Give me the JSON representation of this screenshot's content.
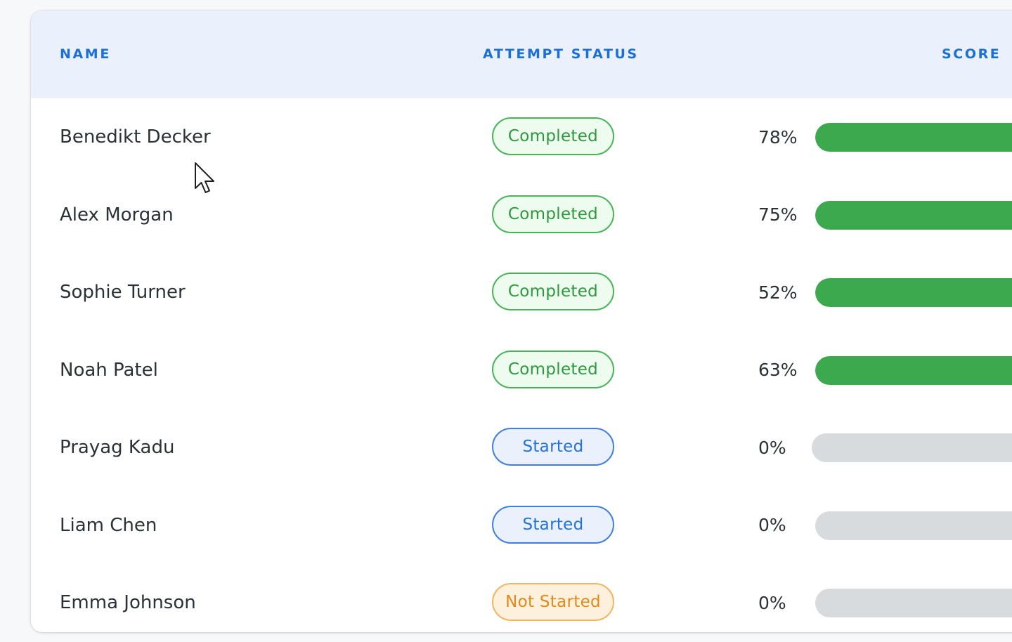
{
  "table": {
    "headers": {
      "name": "NAME",
      "status": "ATTEMPT STATUS",
      "score": "SCORE"
    },
    "rows": [
      {
        "name": "Benedikt Decker",
        "status": "Completed",
        "status_kind": "completed",
        "score": "78%",
        "score_value": 0.78
      },
      {
        "name": "Alex Morgan",
        "status": "Completed",
        "status_kind": "completed",
        "score": "75%",
        "score_value": 0.75
      },
      {
        "name": "Sophie Turner",
        "status": "Completed",
        "status_kind": "completed",
        "score": "52%",
        "score_value": 0.52
      },
      {
        "name": "Noah Patel",
        "status": "Completed",
        "status_kind": "completed",
        "score": "63%",
        "score_value": 0.63
      },
      {
        "name": "Prayag Kadu",
        "status": "Started",
        "status_kind": "started",
        "score": "0%",
        "score_value": 0
      },
      {
        "name": "Liam Chen",
        "status": "Started",
        "status_kind": "started",
        "score": "0%",
        "score_value": 0
      },
      {
        "name": "Emma Johnson",
        "status": "Not Started",
        "status_kind": "not-started",
        "score": "0%",
        "score_value": 0
      }
    ]
  },
  "colors": {
    "accent": "#1b6fd6",
    "header_bg": "#eaf1fd",
    "progress_fill": "#3ca94f",
    "progress_track": "#d8dbde"
  },
  "cursor": {
    "icon": "mouse-pointer-icon"
  }
}
